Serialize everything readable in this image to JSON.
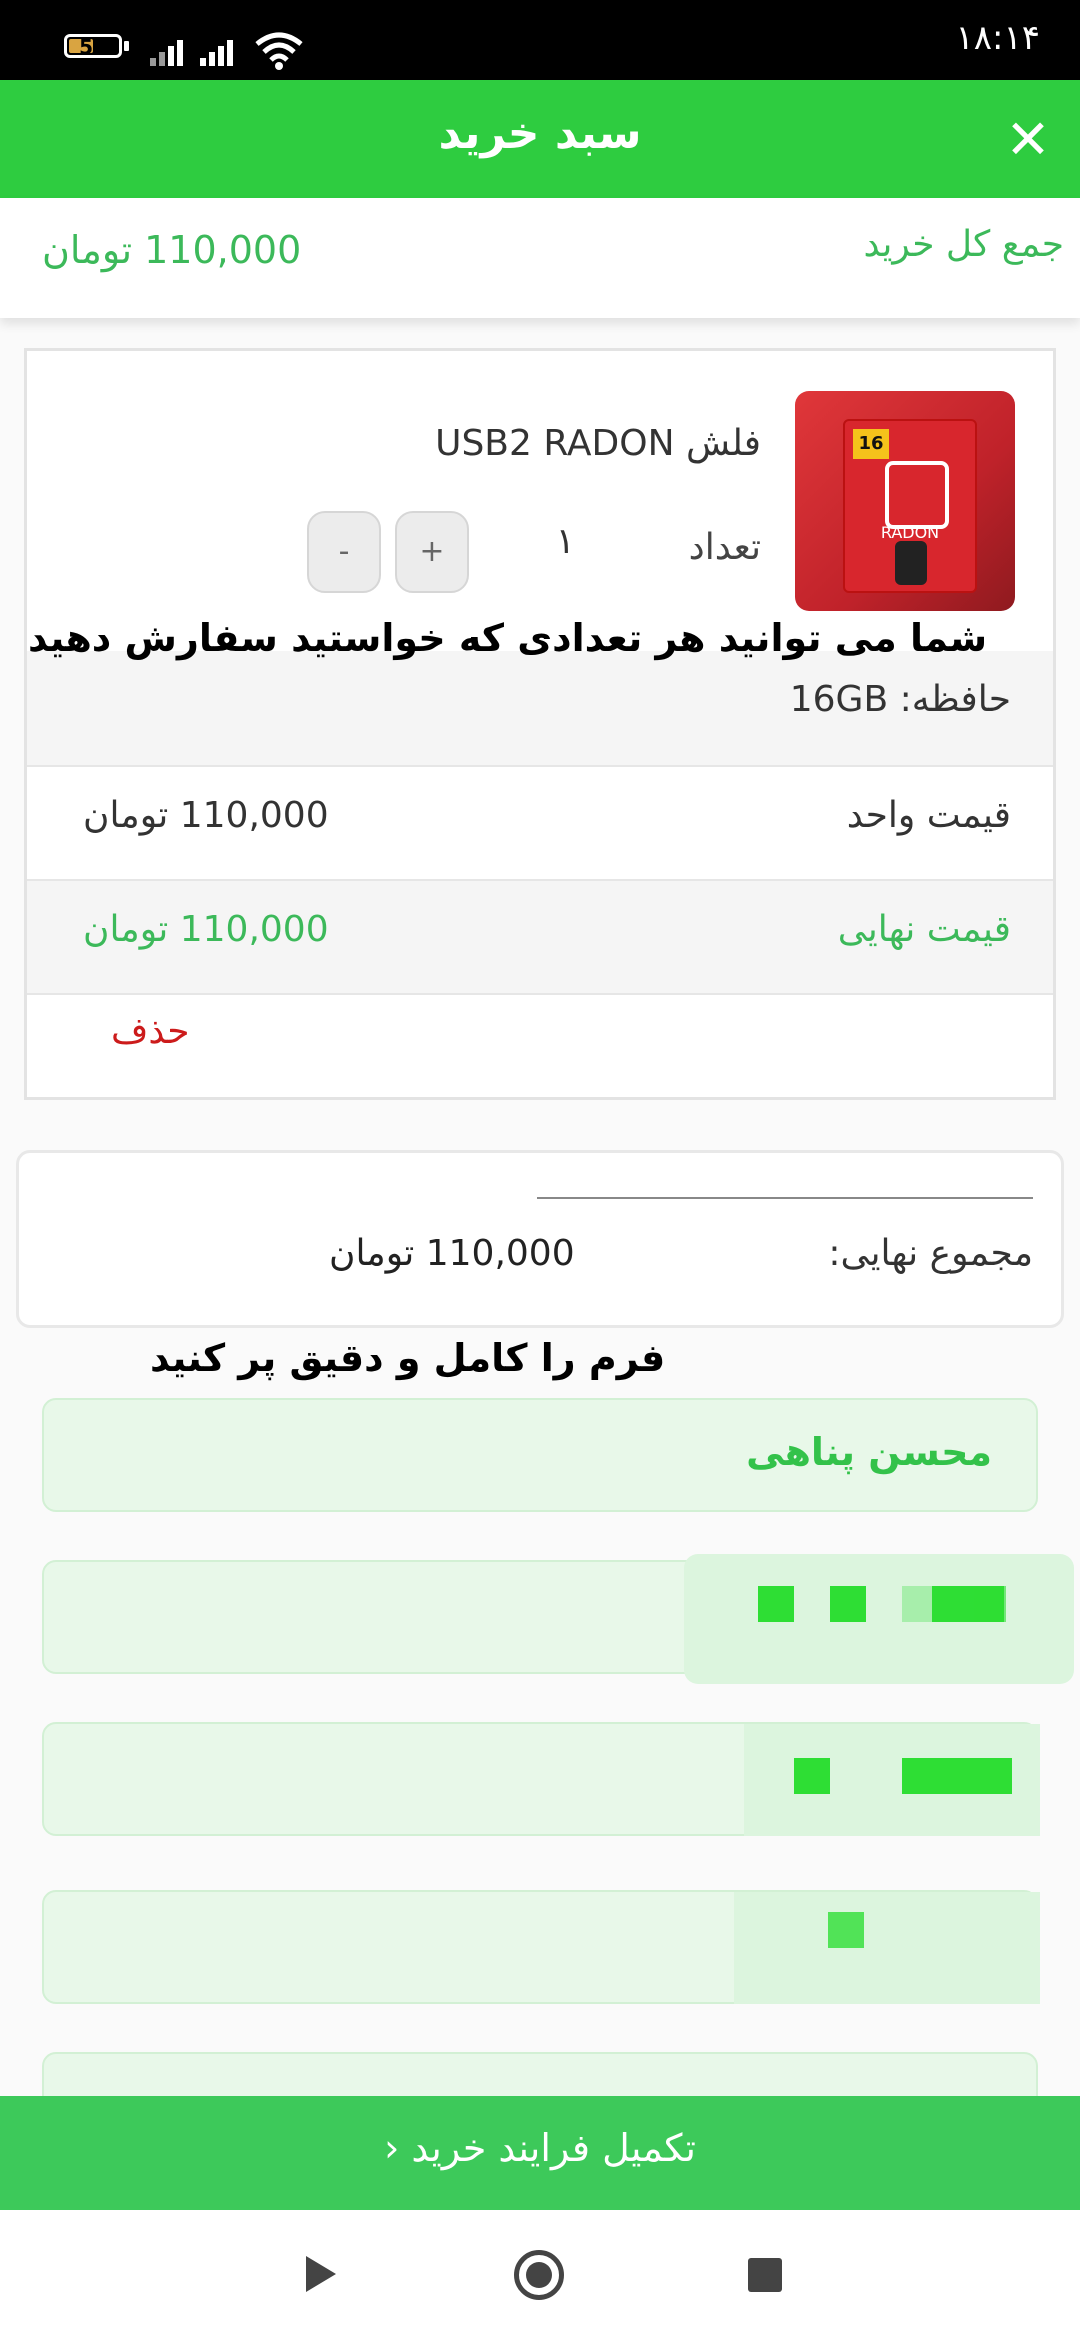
{
  "status_bar": {
    "time": "۱۸:۱۴",
    "battery": "52",
    "battery_fraction": 0.52
  },
  "header": {
    "title": "سبد خرید",
    "close_icon": "close-icon"
  },
  "cart_total": {
    "label": "جمع کل خرید",
    "value": "110,000 تومان"
  },
  "item": {
    "name": "فلش USB2 RADON",
    "image_icon": "product-image",
    "image_badge": "16",
    "image_brand": "RADON",
    "qty_label": "تعداد",
    "qty_value": "۱",
    "qty_plus": "+",
    "qty_minus": "-",
    "spec": "حافظه: 16GB",
    "unit_price_label": "قیمت واحد",
    "unit_price_value": "110,000 تومان",
    "final_price_label": "قیمت نهایی",
    "final_price_value": "110,000 تومان",
    "delete_label": "حذف"
  },
  "overlay_note": "شما می توانید هر تعدادی که خواستید سفارش دهید",
  "summary": {
    "label": "مجموع نهایی:",
    "value": "110,000 تومان"
  },
  "form_note": "فرم را کامل و دقیق پر کنید",
  "form": {
    "name_value": "محسن پناهی"
  },
  "checkout": {
    "label": "تکمیل فرایند خرید ‹"
  },
  "nav": {
    "back_icon": "back-triangle-icon",
    "home_icon": "home-circle-icon",
    "recent_icon": "recent-square-icon"
  },
  "colors": {
    "header": "#2ecc40",
    "accent": "#3cb95a",
    "delete": "#cc1b1b",
    "checkout": "#3dc95a"
  }
}
